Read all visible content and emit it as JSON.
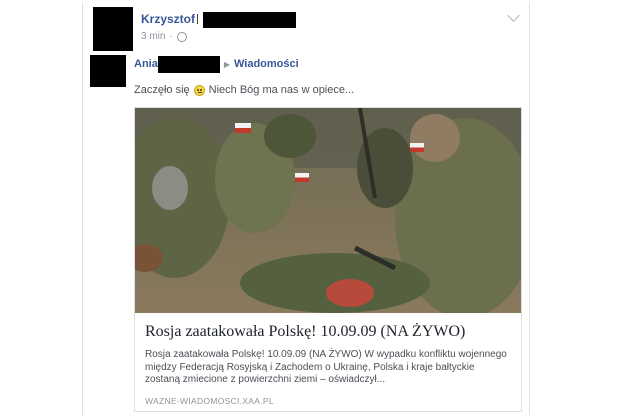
{
  "post": {
    "author_name": "Krzysztof",
    "timestamp": "3 min",
    "visibility_icon": "globe-icon",
    "options_icon": "chevron-down-icon"
  },
  "shared": {
    "sharer_name": "Ania",
    "arrow_icon": "triangle-right-icon",
    "target_page": "Wiadomości"
  },
  "message": {
    "text_before": "Zaczęło się",
    "emoji_icon": "sad-face-icon",
    "text_after": "Niech Bóg ma nas w opiece..."
  },
  "link_preview": {
    "image_icon": "soldiers-photo",
    "title": "Rosja zaatakowała Polskę! 10.09.09 (NA ŻYWO)",
    "description": "Rosja zaatakowała Polskę! 10.09.09 (NA ŻYWO) W wypadku konfliktu wojennego między Federacją Rosyjską i Zachodem o Ukrainę, Polska i kraje bałtyckie zostaną zmiecione z powierzchni ziemi – oświadczył...",
    "domain": "WAZNE-WIADOMOSCI.XAA.PL"
  },
  "colors": {
    "link_blue": "#365899",
    "meta_gray": "#90949c",
    "text": "#1d2129"
  }
}
